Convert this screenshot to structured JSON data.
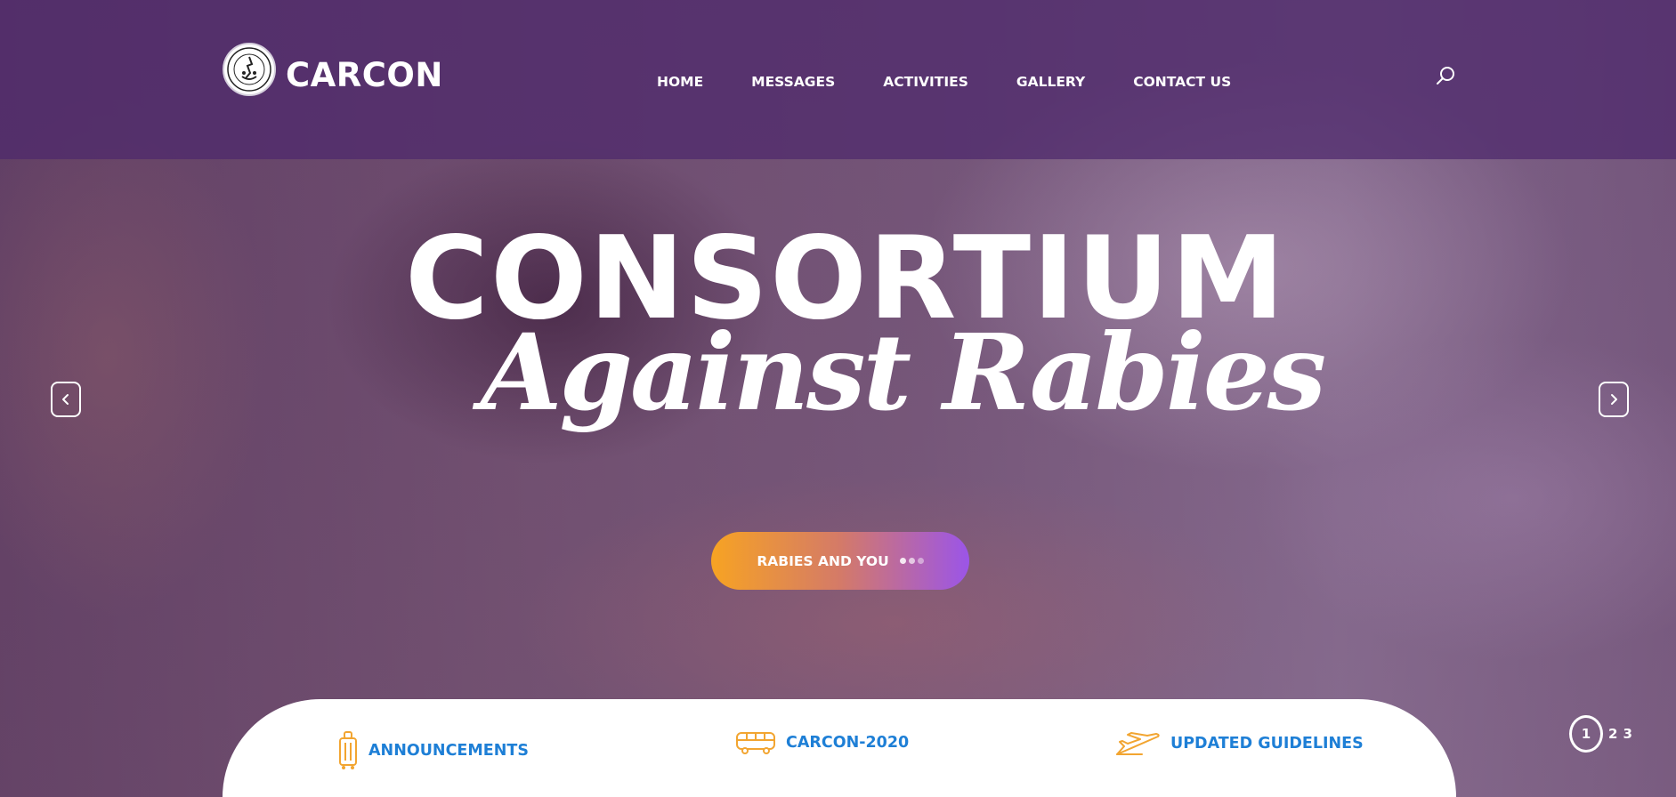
{
  "header": {
    "logo_text": "CARCON",
    "nav": [
      {
        "label": "HOME"
      },
      {
        "label": "MESSAGES"
      },
      {
        "label": "ACTIVITIES"
      },
      {
        "label": "GALLERY"
      },
      {
        "label": "CONTACT US"
      }
    ],
    "search_icon": "search-icon"
  },
  "hero": {
    "title": "CONSORTIUM",
    "subtitle": "Against Rabies",
    "cta_label": "RABIES AND YOU",
    "prev_icon": "chevron-left-icon",
    "next_icon": "chevron-right-icon"
  },
  "pagination": {
    "active": "1",
    "pages": [
      "2",
      "3"
    ]
  },
  "features": [
    {
      "label": "ANNOUNCEMENTS",
      "icon": "luggage-icon"
    },
    {
      "label": "CARCON-2020",
      "icon": "bus-icon"
    },
    {
      "label": "UPDATED GUIDELINES",
      "icon": "airplane-icon"
    }
  ],
  "colors": {
    "header_bg": "#4e286c",
    "accent_blue": "#1e7fd6",
    "icon_orange": "#f2a531",
    "cta_start": "#f7a323",
    "cta_end": "#9b55e8"
  }
}
